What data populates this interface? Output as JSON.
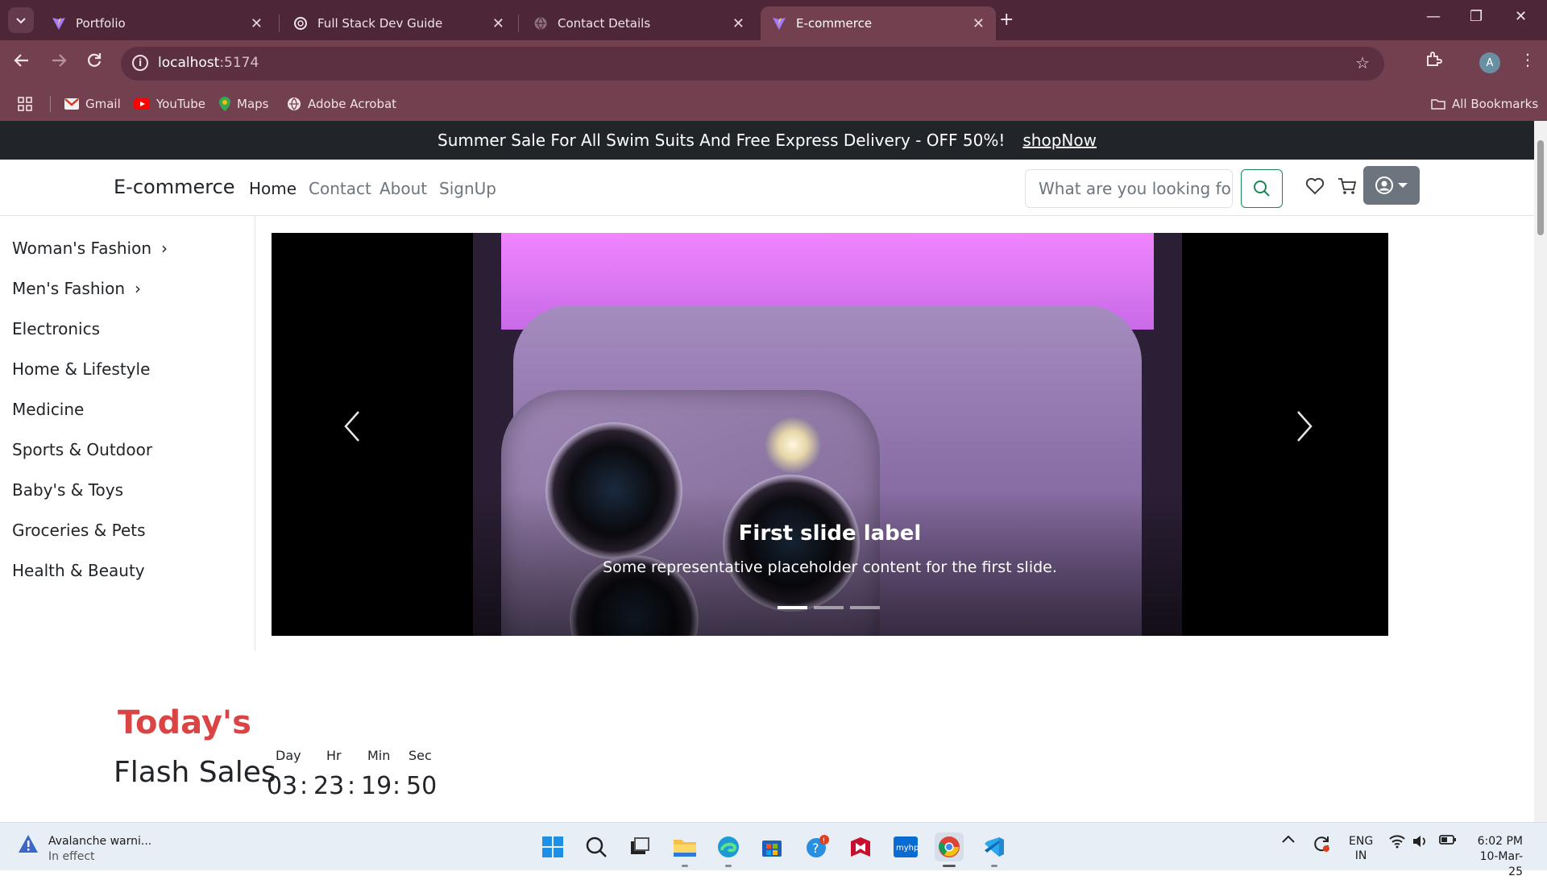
{
  "browser": {
    "tabs": [
      {
        "label": "Portfolio",
        "icon": "vite-icon"
      },
      {
        "label": "Full Stack Dev Guide",
        "icon": "chatgpt-icon"
      },
      {
        "label": "Contact Details",
        "icon": "globe-icon"
      },
      {
        "label": "E-commerce",
        "icon": "vite-icon",
        "active": true
      }
    ],
    "url_host": "localhost",
    "url_port": ":5174",
    "profile_initial": "A",
    "bookmarks": [
      "Gmail",
      "YouTube",
      "Maps",
      "Adobe Acrobat"
    ],
    "all_bookmarks": "All Bookmarks"
  },
  "promo": {
    "text": "Summer Sale For All Swim Suits And Free Express Delivery - OFF 50%!",
    "link": "shopNow"
  },
  "navbar": {
    "brand": "E-commerce",
    "links": [
      "Home",
      "Contact",
      "About",
      "SignUp"
    ],
    "active_link": "Home",
    "search_placeholder": "What are you looking fo"
  },
  "sidebar": {
    "categories": [
      {
        "label": "Woman's Fashion",
        "has_submenu": true
      },
      {
        "label": "Men's Fashion",
        "has_submenu": true
      },
      {
        "label": "Electronics"
      },
      {
        "label": "Home & Lifestyle"
      },
      {
        "label": "Medicine"
      },
      {
        "label": "Sports & Outdoor"
      },
      {
        "label": "Baby's & Toys"
      },
      {
        "label": "Groceries & Pets"
      },
      {
        "label": "Health & Beauty"
      }
    ]
  },
  "carousel": {
    "caption_title": "First slide label",
    "caption_text": "Some representative placeholder content for the first slide.",
    "slide_count": 3,
    "active_slide": 1
  },
  "flash_sales": {
    "eyebrow": "Today's",
    "title": "Flash Sales",
    "countdown": {
      "labels": [
        "Day",
        "Hr",
        "Min",
        "Sec"
      ],
      "values": [
        "03",
        "23",
        "19",
        "50"
      ],
      "separator": ":"
    }
  },
  "taskbar": {
    "alert_title": "Avalanche warni...",
    "alert_status": "In effect",
    "language": "ENG",
    "region": "IN",
    "time": "6:02 PM",
    "date": "10-Mar-25"
  },
  "colors": {
    "tabbar": "#4d2738",
    "toolbar": "#73404f",
    "accent_red": "#db4444",
    "promo_bg": "#212529",
    "search_green": "#198754"
  }
}
